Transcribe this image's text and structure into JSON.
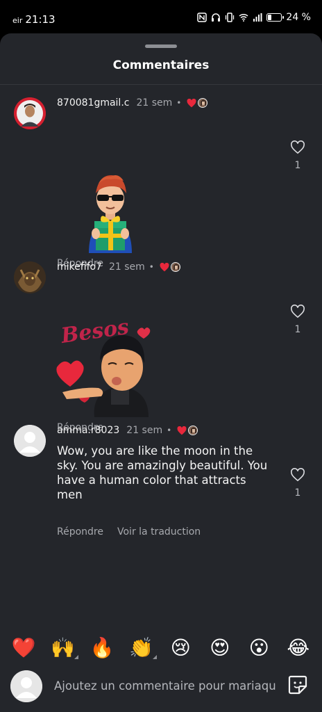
{
  "status_bar": {
    "carrier": "eir",
    "time": "21:13",
    "battery_text": "24 %",
    "battery_level": 0.24
  },
  "sheet": {
    "title": "Commentaires"
  },
  "comments": [
    {
      "username": "870081gmail.c",
      "time": "21 sem",
      "dot": "•",
      "type": "sticker",
      "sticker": "avatar-gift-sticker",
      "likes": "1",
      "reply_label": "Répondre"
    },
    {
      "username": "mikefifo7",
      "time": "21 sem",
      "dot": "•",
      "type": "sticker",
      "sticker": "besos-kiss-sticker",
      "sticker_text": "Besos",
      "likes": "1",
      "reply_label": "Répondre"
    },
    {
      "username": "amma.r8023",
      "time": "21 sem",
      "dot": "•",
      "type": "text",
      "text": "Wow, you are like the moon in the sky. You are amazingly beautiful. You have a human color that attracts men",
      "likes": "1",
      "reply_label": "Répondre",
      "translate_label": "Voir la traduction"
    }
  ],
  "emoji_bar": [
    {
      "glyph": "❤️",
      "name": "red-heart"
    },
    {
      "glyph": "🙌",
      "name": "raising-hands"
    },
    {
      "glyph": "🔥",
      "name": "fire"
    },
    {
      "glyph": "👏",
      "name": "clapping-hands"
    },
    {
      "glyph": "😢",
      "name": "crying-face"
    },
    {
      "glyph": "😍",
      "name": "heart-eyes"
    },
    {
      "glyph": "😮",
      "name": "surprised-face"
    },
    {
      "glyph": "😂",
      "name": "tears-of-joy"
    }
  ],
  "input": {
    "placeholder": "Ajoutez un commentaire pour mariaqu"
  },
  "colors": {
    "sheet_bg": "#24262b",
    "like_heart": "#e8283c",
    "muted_text": "#a7a9ae"
  }
}
